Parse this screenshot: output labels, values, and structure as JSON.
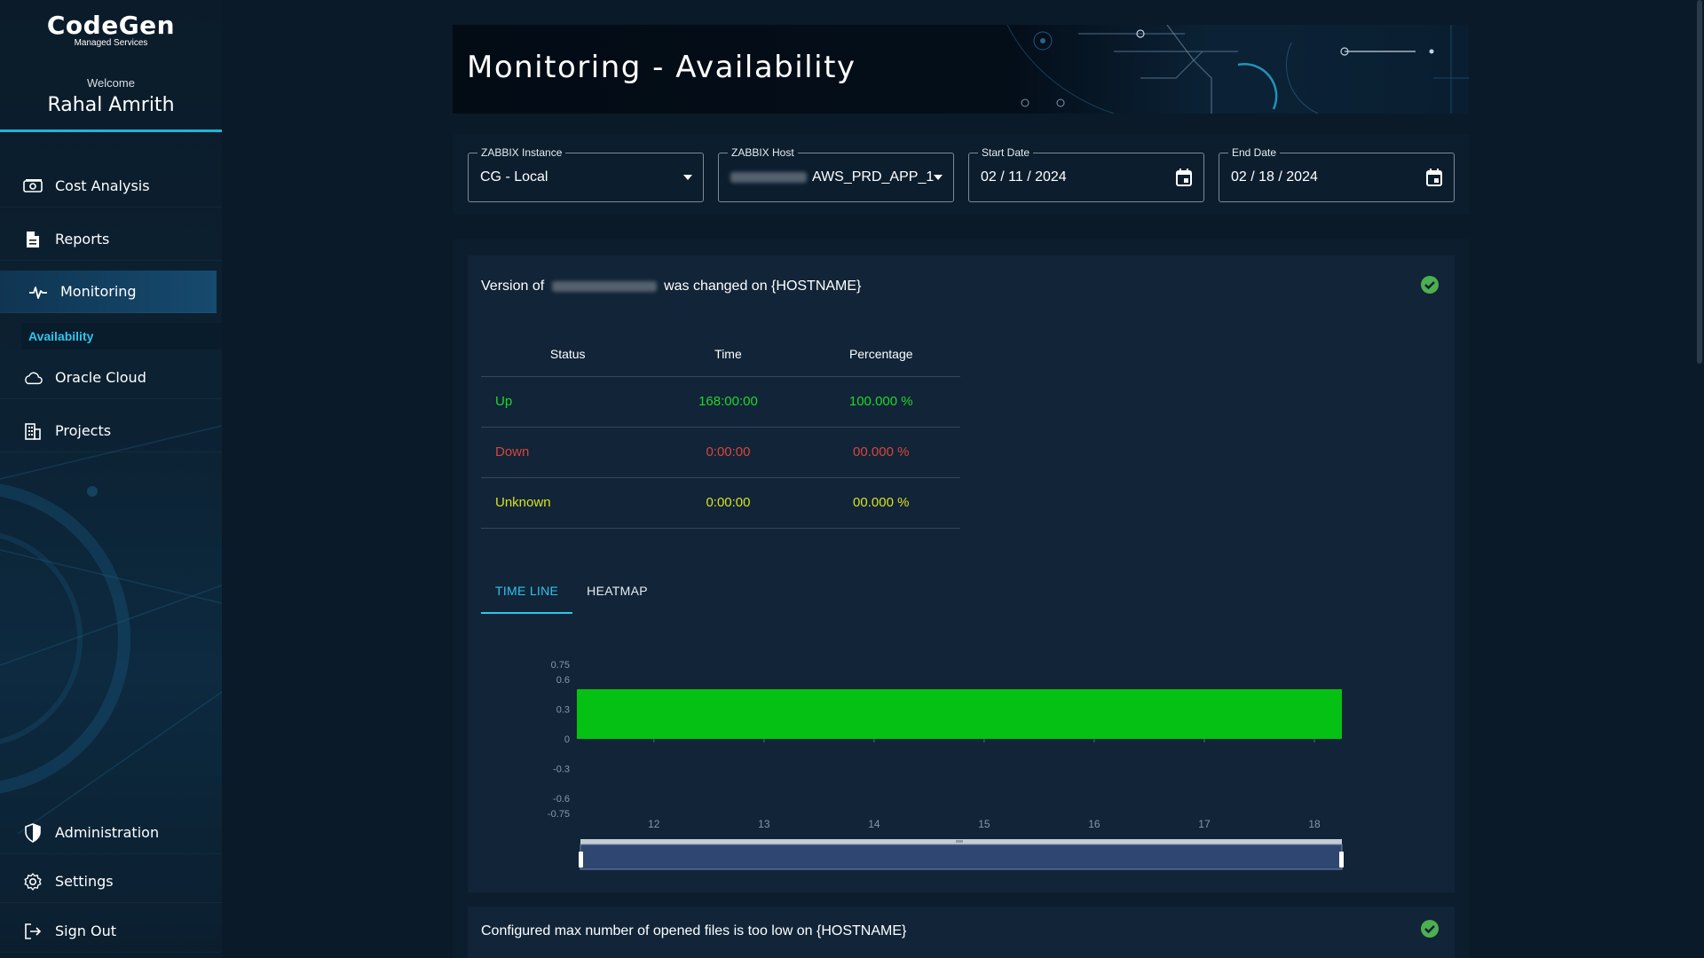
{
  "brand": {
    "name": "CodeGen",
    "subtitle": "Managed Services"
  },
  "user": {
    "welcome": "Welcome",
    "name": "Rahal Amrith"
  },
  "nav": {
    "cost_analysis": "Cost Analysis",
    "reports": "Reports",
    "monitoring": "Monitoring",
    "availability": "Availability",
    "oracle_cloud": "Oracle Cloud",
    "projects": "Projects",
    "administration": "Administration",
    "settings": "Settings",
    "sign_out": "Sign Out"
  },
  "header": {
    "title": "Monitoring - Availability"
  },
  "filters": {
    "instance_label": "ZABBIX Instance",
    "instance_value": "CG - Local",
    "host_label": "ZABBIX Host",
    "host_value": "AWS_PRD_APP_1",
    "start_label": "Start Date",
    "start_value": "02 / 11 / 2024",
    "end_label": "End Date",
    "end_value": "02 / 18 / 2024"
  },
  "trigger1": {
    "title_prefix": "Version of",
    "title_suffix": "was changed on {HOSTNAME}",
    "table": {
      "headers": [
        "Status",
        "Time",
        "Percentage"
      ],
      "rows": [
        [
          "Up",
          "168:00:00",
          "100.000 %"
        ],
        [
          "Down",
          "0:00:00",
          "00.000 %"
        ],
        [
          "Unknown",
          "0:00:00",
          "00.000 %"
        ]
      ]
    },
    "tabs": [
      "TIME LINE",
      "HEATMAP"
    ]
  },
  "trigger2": {
    "title": "Configured max number of opened files is too low on {HOSTNAME}"
  },
  "colors": {
    "accent": "#2ec5ee",
    "up": "#20d72a",
    "down": "#d9453b",
    "unknown": "#d9e21c",
    "bar": "#04c114"
  },
  "chart_data": {
    "type": "bar",
    "x_ticks": [
      "12",
      "13",
      "14",
      "15",
      "16",
      "17",
      "18"
    ],
    "y_ticks": [
      "0.75",
      "0.6",
      "0.3",
      "0",
      "-0.3",
      "-0.6",
      "-0.75"
    ],
    "ylim": [
      -0.75,
      0.75
    ],
    "xlim": [
      11.3,
      18.25
    ],
    "series": [
      {
        "status": "Up",
        "start": 11.3,
        "end": 18.25,
        "value": 0.5
      }
    ]
  }
}
